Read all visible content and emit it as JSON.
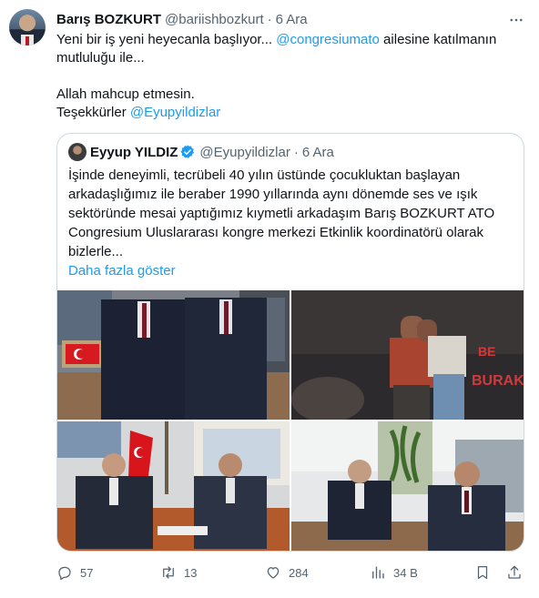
{
  "tweet": {
    "author_name": "Barış BOZKURT",
    "author_handle": "@bariishbozkurt",
    "separator": "·",
    "time": "6 Ara",
    "text_lines": [
      [
        "Yeni bir iş yeni heyecanla başlıyor... ",
        "@congresiumato",
        " ailesine katılmanın"
      ],
      [
        "mutluluğu ile..."
      ],
      [
        ""
      ],
      [
        "Allah mahcup etmesin."
      ],
      [
        "Teşekkürler ",
        "@Eyupyildizlar"
      ]
    ]
  },
  "quoted": {
    "author_name": "Eyyup YILDIZ",
    "author_handle": "@Eyupyildizlar",
    "separator": "·",
    "time": "6 Ara",
    "verified_color": "#1d9bf0",
    "text_lines": [
      "İşinde deneyimli, tecrübeli 40 yılın üstünde çocukluktan başlayan",
      "arkadaşlığımız ile beraber 1990 yıllarında aynı dönemde ses ve ışık",
      "sektöründe mesai yaptığımız kıymetli arkadaşım Barış BOZKURT ATO",
      "Congresium Uluslararası kongre merkezi  Etkinlik koordinatörü olarak",
      "bizlerle..."
    ],
    "show_more": "Daha fazla göster",
    "photo2_sign": [
      "BE",
      "BURAK"
    ]
  },
  "actions": {
    "replies": "57",
    "retweets": "13",
    "likes": "284",
    "views": "34 B"
  },
  "colors": {
    "link": "#1d9bf0",
    "secondary": "#536471",
    "border": "#cfd9de"
  }
}
